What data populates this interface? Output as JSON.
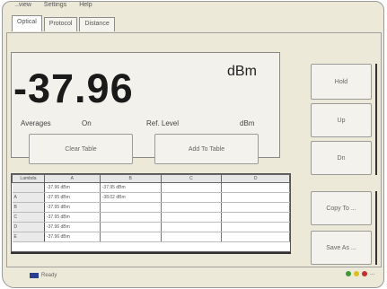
{
  "menu": [
    "..view",
    "Settings",
    "Help"
  ],
  "tabs": [
    {
      "label": "Optical"
    },
    {
      "label": "Protocol"
    },
    {
      "label": "Distance"
    }
  ],
  "readout": {
    "value": "-37.96",
    "unit": "dBm",
    "average_label": "Averages",
    "average_value": "On",
    "ref_label": "Ref. Level",
    "ref_value": "dBm"
  },
  "side_buttons": {
    "hold": "Hold",
    "up": "Up",
    "down": "Dn",
    "copy": "Copy To ...",
    "save": "Save As ..."
  },
  "action_buttons": {
    "clear": "Clear Table",
    "add": "Add To Table"
  },
  "table": {
    "columns": [
      "Lambda",
      "A",
      "B",
      "C",
      "D"
    ],
    "rows": [
      {
        "label": "",
        "a": "-37.96 dBm",
        "b": "-37.95 dBm",
        "c": "",
        "d": ""
      },
      {
        "label": "A",
        "a": "-37.95 dBm",
        "b": "-38.02 dBm",
        "c": "",
        "d": ""
      },
      {
        "label": "B",
        "a": "-37.95 dBm",
        "b": "",
        "c": "",
        "d": ""
      },
      {
        "label": "C",
        "a": "-37.95 dBm",
        "b": "",
        "c": "",
        "d": ""
      },
      {
        "label": "D",
        "a": "-37.96 dBm",
        "b": "",
        "c": "",
        "d": ""
      },
      {
        "label": "E",
        "a": "-37.96 dBm",
        "b": "",
        "c": "",
        "d": ""
      }
    ]
  },
  "status": {
    "text": "Ready"
  },
  "tray": {
    "time": "..."
  },
  "colors": {
    "status_block": "#2a3d8f",
    "tray_green": "#3a9a3a",
    "tray_yellow": "#d8c21e",
    "tray_red": "#c03030"
  }
}
